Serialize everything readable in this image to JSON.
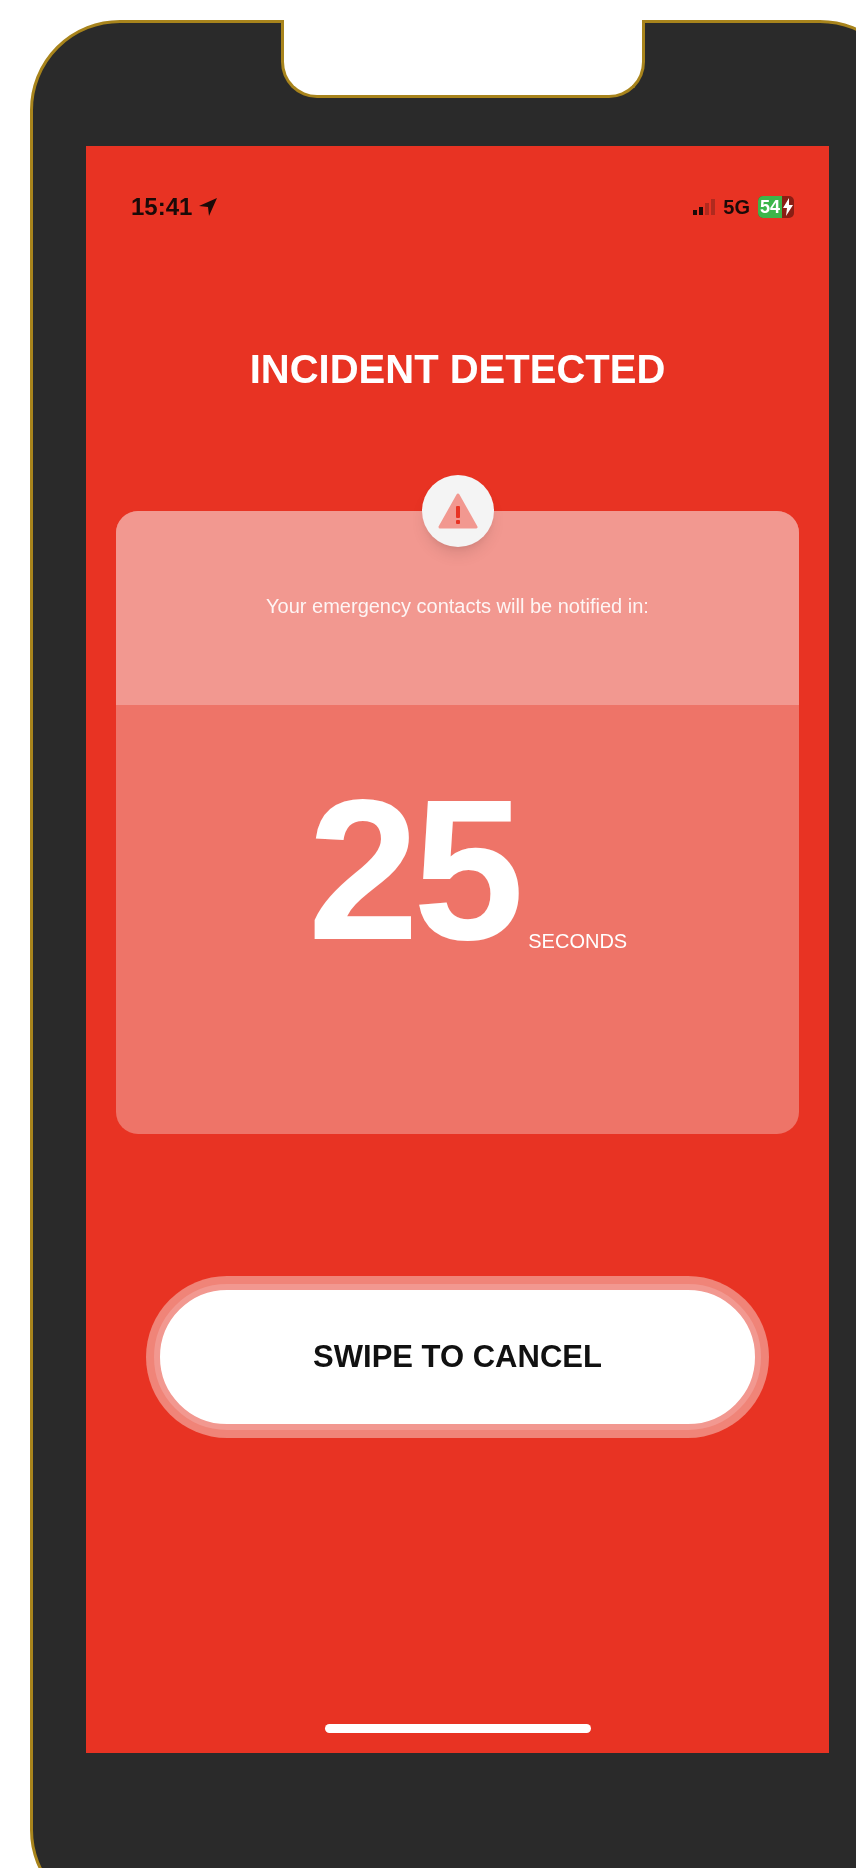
{
  "status_bar": {
    "time": "15:41",
    "network": "5G",
    "battery": "54"
  },
  "title": "INCIDENT DETECTED",
  "card": {
    "message": "Your emergency contacts will be notified in:",
    "count": "25",
    "unit": "SECONDS"
  },
  "cancel_button": {
    "label": "SWIPE TO CANCEL"
  }
}
